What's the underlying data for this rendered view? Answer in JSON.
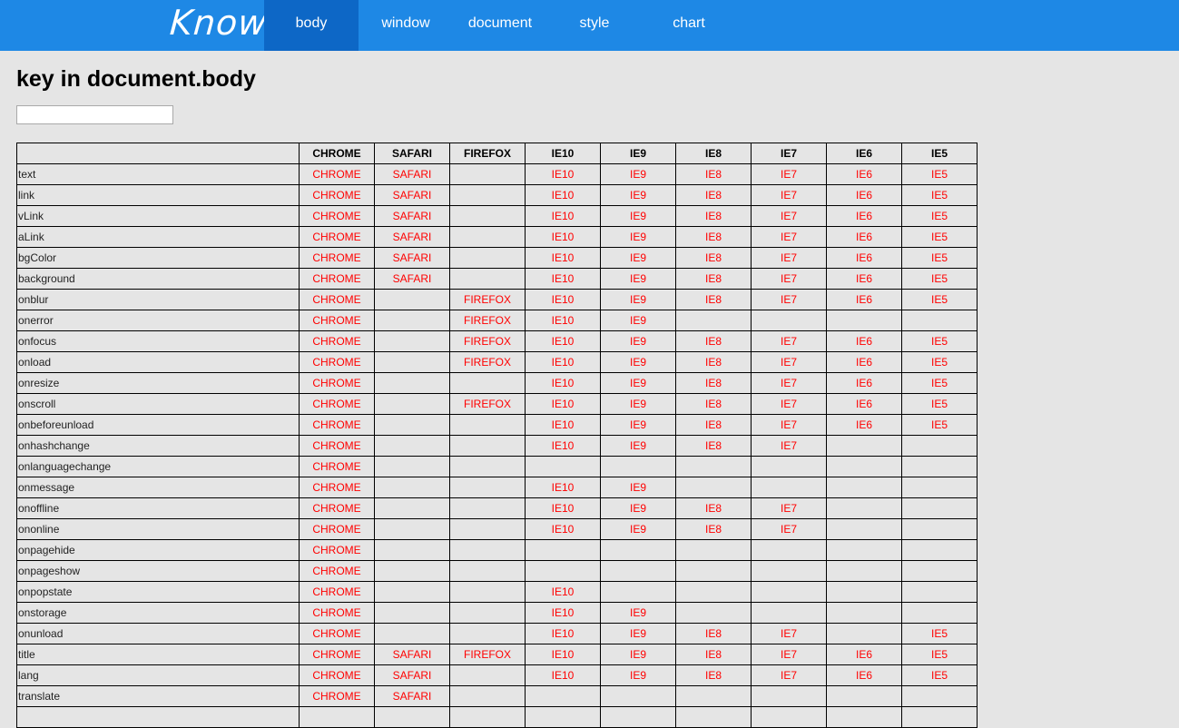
{
  "header": {
    "logo": "Know",
    "nav": [
      {
        "label": "body",
        "active": true
      },
      {
        "label": "window",
        "active": false
      },
      {
        "label": "document",
        "active": false
      },
      {
        "label": "style",
        "active": false
      },
      {
        "label": "chart",
        "active": false
      }
    ]
  },
  "page": {
    "title": "key in document.body",
    "search": {
      "value": "",
      "placeholder": ""
    }
  },
  "table": {
    "columns": [
      "CHROME",
      "SAFARI",
      "FIREFOX",
      "IE10",
      "IE9",
      "IE8",
      "IE7",
      "IE6",
      "IE5"
    ],
    "rows": [
      {
        "key": "text",
        "cells": [
          "CHROME",
          "SAFARI",
          "",
          "IE10",
          "IE9",
          "IE8",
          "IE7",
          "IE6",
          "IE5"
        ]
      },
      {
        "key": "link",
        "cells": [
          "CHROME",
          "SAFARI",
          "",
          "IE10",
          "IE9",
          "IE8",
          "IE7",
          "IE6",
          "IE5"
        ]
      },
      {
        "key": "vLink",
        "cells": [
          "CHROME",
          "SAFARI",
          "",
          "IE10",
          "IE9",
          "IE8",
          "IE7",
          "IE6",
          "IE5"
        ]
      },
      {
        "key": "aLink",
        "cells": [
          "CHROME",
          "SAFARI",
          "",
          "IE10",
          "IE9",
          "IE8",
          "IE7",
          "IE6",
          "IE5"
        ]
      },
      {
        "key": "bgColor",
        "cells": [
          "CHROME",
          "SAFARI",
          "",
          "IE10",
          "IE9",
          "IE8",
          "IE7",
          "IE6",
          "IE5"
        ]
      },
      {
        "key": "background",
        "cells": [
          "CHROME",
          "SAFARI",
          "",
          "IE10",
          "IE9",
          "IE8",
          "IE7",
          "IE6",
          "IE5"
        ]
      },
      {
        "key": "onblur",
        "cells": [
          "CHROME",
          "",
          "FIREFOX",
          "IE10",
          "IE9",
          "IE8",
          "IE7",
          "IE6",
          "IE5"
        ]
      },
      {
        "key": "onerror",
        "cells": [
          "CHROME",
          "",
          "FIREFOX",
          "IE10",
          "IE9",
          "",
          "",
          "",
          ""
        ]
      },
      {
        "key": "onfocus",
        "cells": [
          "CHROME",
          "",
          "FIREFOX",
          "IE10",
          "IE9",
          "IE8",
          "IE7",
          "IE6",
          "IE5"
        ]
      },
      {
        "key": "onload",
        "cells": [
          "CHROME",
          "",
          "FIREFOX",
          "IE10",
          "IE9",
          "IE8",
          "IE7",
          "IE6",
          "IE5"
        ]
      },
      {
        "key": "onresize",
        "cells": [
          "CHROME",
          "",
          "",
          "IE10",
          "IE9",
          "IE8",
          "IE7",
          "IE6",
          "IE5"
        ]
      },
      {
        "key": "onscroll",
        "cells": [
          "CHROME",
          "",
          "FIREFOX",
          "IE10",
          "IE9",
          "IE8",
          "IE7",
          "IE6",
          "IE5"
        ]
      },
      {
        "key": "onbeforeunload",
        "cells": [
          "CHROME",
          "",
          "",
          "IE10",
          "IE9",
          "IE8",
          "IE7",
          "IE6",
          "IE5"
        ]
      },
      {
        "key": "onhashchange",
        "cells": [
          "CHROME",
          "",
          "",
          "IE10",
          "IE9",
          "IE8",
          "IE7",
          "",
          ""
        ]
      },
      {
        "key": "onlanguagechange",
        "cells": [
          "CHROME",
          "",
          "",
          "",
          "",
          "",
          "",
          "",
          ""
        ]
      },
      {
        "key": "onmessage",
        "cells": [
          "CHROME",
          "",
          "",
          "IE10",
          "IE9",
          "",
          "",
          "",
          ""
        ]
      },
      {
        "key": "onoffline",
        "cells": [
          "CHROME",
          "",
          "",
          "IE10",
          "IE9",
          "IE8",
          "IE7",
          "",
          ""
        ]
      },
      {
        "key": "ononline",
        "cells": [
          "CHROME",
          "",
          "",
          "IE10",
          "IE9",
          "IE8",
          "IE7",
          "",
          ""
        ]
      },
      {
        "key": "onpagehide",
        "cells": [
          "CHROME",
          "",
          "",
          "",
          "",
          "",
          "",
          "",
          ""
        ]
      },
      {
        "key": "onpageshow",
        "cells": [
          "CHROME",
          "",
          "",
          "",
          "",
          "",
          "",
          "",
          ""
        ]
      },
      {
        "key": "onpopstate",
        "cells": [
          "CHROME",
          "",
          "",
          "IE10",
          "",
          "",
          "",
          "",
          ""
        ]
      },
      {
        "key": "onstorage",
        "cells": [
          "CHROME",
          "",
          "",
          "IE10",
          "IE9",
          "",
          "",
          "",
          ""
        ]
      },
      {
        "key": "onunload",
        "cells": [
          "CHROME",
          "",
          "",
          "IE10",
          "IE9",
          "IE8",
          "IE7",
          "",
          "IE5"
        ]
      },
      {
        "key": "title",
        "cells": [
          "CHROME",
          "SAFARI",
          "FIREFOX",
          "IE10",
          "IE9",
          "IE8",
          "IE7",
          "IE6",
          "IE5"
        ]
      },
      {
        "key": "lang",
        "cells": [
          "CHROME",
          "SAFARI",
          "",
          "IE10",
          "IE9",
          "IE8",
          "IE7",
          "IE6",
          "IE5"
        ]
      },
      {
        "key": "translate",
        "cells": [
          "CHROME",
          "SAFARI",
          "",
          "",
          "",
          "",
          "",
          "",
          ""
        ]
      },
      {
        "key": "",
        "cells": [
          "",
          "",
          "",
          "",
          "",
          "",
          "",
          "",
          ""
        ]
      }
    ]
  },
  "colors": {
    "header_bg": "#1e88e5",
    "nav_active_bg": "#0d67c6",
    "page_bg": "#e5e5e5",
    "supported_text": "#ff0000"
  }
}
